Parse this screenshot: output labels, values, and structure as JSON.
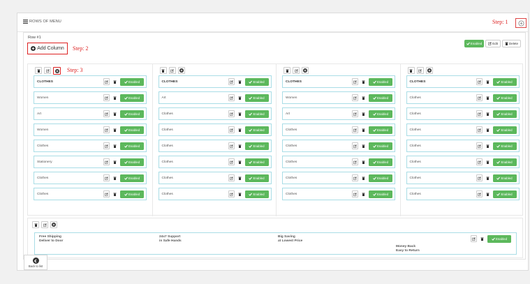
{
  "header": {
    "title": "ROWS OF MENU",
    "step1": "Step: 1",
    "add_row_icon": "plus-circle-icon"
  },
  "row": {
    "title": "Row #1",
    "add_column_label": "Add Column",
    "step2": "Step: 2",
    "step3": "Step: 3",
    "enabled_label": "Enabled",
    "edit_label": "Edit",
    "delete_label": "Delete"
  },
  "columns": [
    {
      "items": [
        "CLOTHES",
        "Women",
        "Art",
        "Women",
        "Clothes",
        "Stationery",
        "Clothes",
        "Clothes"
      ]
    },
    {
      "items": [
        "CLOTHES",
        "Art",
        "Clothes",
        "Clothes",
        "Clothes",
        "Clothes",
        "Clothes",
        "Clothes"
      ]
    },
    {
      "items": [
        "CLOTHES",
        "Women",
        "Art",
        "Clothes",
        "Clothes",
        "Clothes",
        "Clothes",
        "Clothes"
      ]
    },
    {
      "items": [
        "CLOTHES",
        "Clothes",
        "Clothes",
        "Clothes",
        "Clothes",
        "Clothes",
        "Clothes",
        "Clothes"
      ]
    }
  ],
  "item_enabled_label": "Enabled",
  "footer_block": {
    "cells": [
      {
        "line1": "Free Shipping",
        "line2": "Deliver to Door"
      },
      {
        "line1": "24x7 Support",
        "line2": "in Safe Hands"
      },
      {
        "line1": "Big Saving",
        "line2": "at Lowest Price"
      },
      {
        "line1": "Money Back",
        "line2": "Easy to Return"
      }
    ],
    "enabled_label": "Enabled"
  },
  "back_button": {
    "label": "Back to list"
  },
  "colors": {
    "green": "#5cb85c",
    "highlight": "#dd2222",
    "item_border": "#a9dde6"
  }
}
